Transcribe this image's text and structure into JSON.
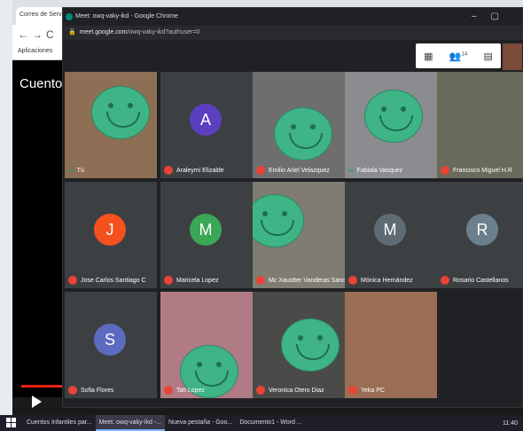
{
  "background_browser": {
    "tab_label": "Correo de Servi",
    "bookmarks_label": "Aplicaciones",
    "content_title": "Cuentos"
  },
  "meet_window": {
    "title": "Meet: owq-vaky-ikd - Google Chrome",
    "url_host": "meet.google.com",
    "url_path": "/owq-vaky-ikd?authuser=0",
    "participant_count": "14",
    "toolbar_icons": [
      "grid-icon",
      "people-icon",
      "chat-icon"
    ]
  },
  "participants": [
    {
      "name": "Tú",
      "type": "video",
      "bg": "#8c6f55",
      "mic": "on"
    },
    {
      "name": "Araleymi Elizalde",
      "type": "avatar",
      "initial": "A",
      "color": "#5c3ec1",
      "mic": "muted"
    },
    {
      "name": "Emilio Ariel Velazquez",
      "type": "video",
      "bg": "#6e6e6e",
      "mic": "muted"
    },
    {
      "name": "Fabiola Vasquez",
      "type": "video",
      "bg": "#8a8c90",
      "mic": "on"
    },
    {
      "name": "Francisco Miguel H.R",
      "type": "video",
      "bg": "#6a6a5a",
      "mic": "muted"
    },
    {
      "name": "Jose Carlos Santiago C",
      "type": "avatar",
      "initial": "J",
      "color": "#f4511e",
      "mic": "muted"
    },
    {
      "name": "Maricela Lopez",
      "type": "avatar",
      "initial": "M",
      "color": "#3aa757",
      "mic": "muted"
    },
    {
      "name": "Mc Xaustter Vanderas Sanch...",
      "type": "video",
      "bg": "#7f7c72",
      "mic": "muted"
    },
    {
      "name": "Mónica Hernández",
      "type": "avatar",
      "initial": "M",
      "color": "#5f6b73",
      "mic": "muted"
    },
    {
      "name": "Rosario Castellanos",
      "type": "avatar",
      "initial": "R",
      "color": "#6b7f8c",
      "mic": "muted"
    },
    {
      "name": "Sofia Flores",
      "type": "avatar",
      "initial": "S",
      "color": "#5c6bc0",
      "mic": "muted"
    },
    {
      "name": "Tati Lopez",
      "type": "video",
      "bg": "#b07b84",
      "mic": "muted"
    },
    {
      "name": "Veronica Otero Diaz",
      "type": "video",
      "bg": "#4a4a48",
      "mic": "muted"
    },
    {
      "name": "Yeka PC",
      "type": "video",
      "bg": "#9a6d55",
      "mic": "muted"
    }
  ],
  "taskbar": {
    "items": [
      "Cuentos Infantiles par...",
      "Meet: owq-vaky-ikd -...",
      "Nueva pestaña - Goo...",
      "Documento1 - Word ..."
    ],
    "clock": "11:40"
  }
}
